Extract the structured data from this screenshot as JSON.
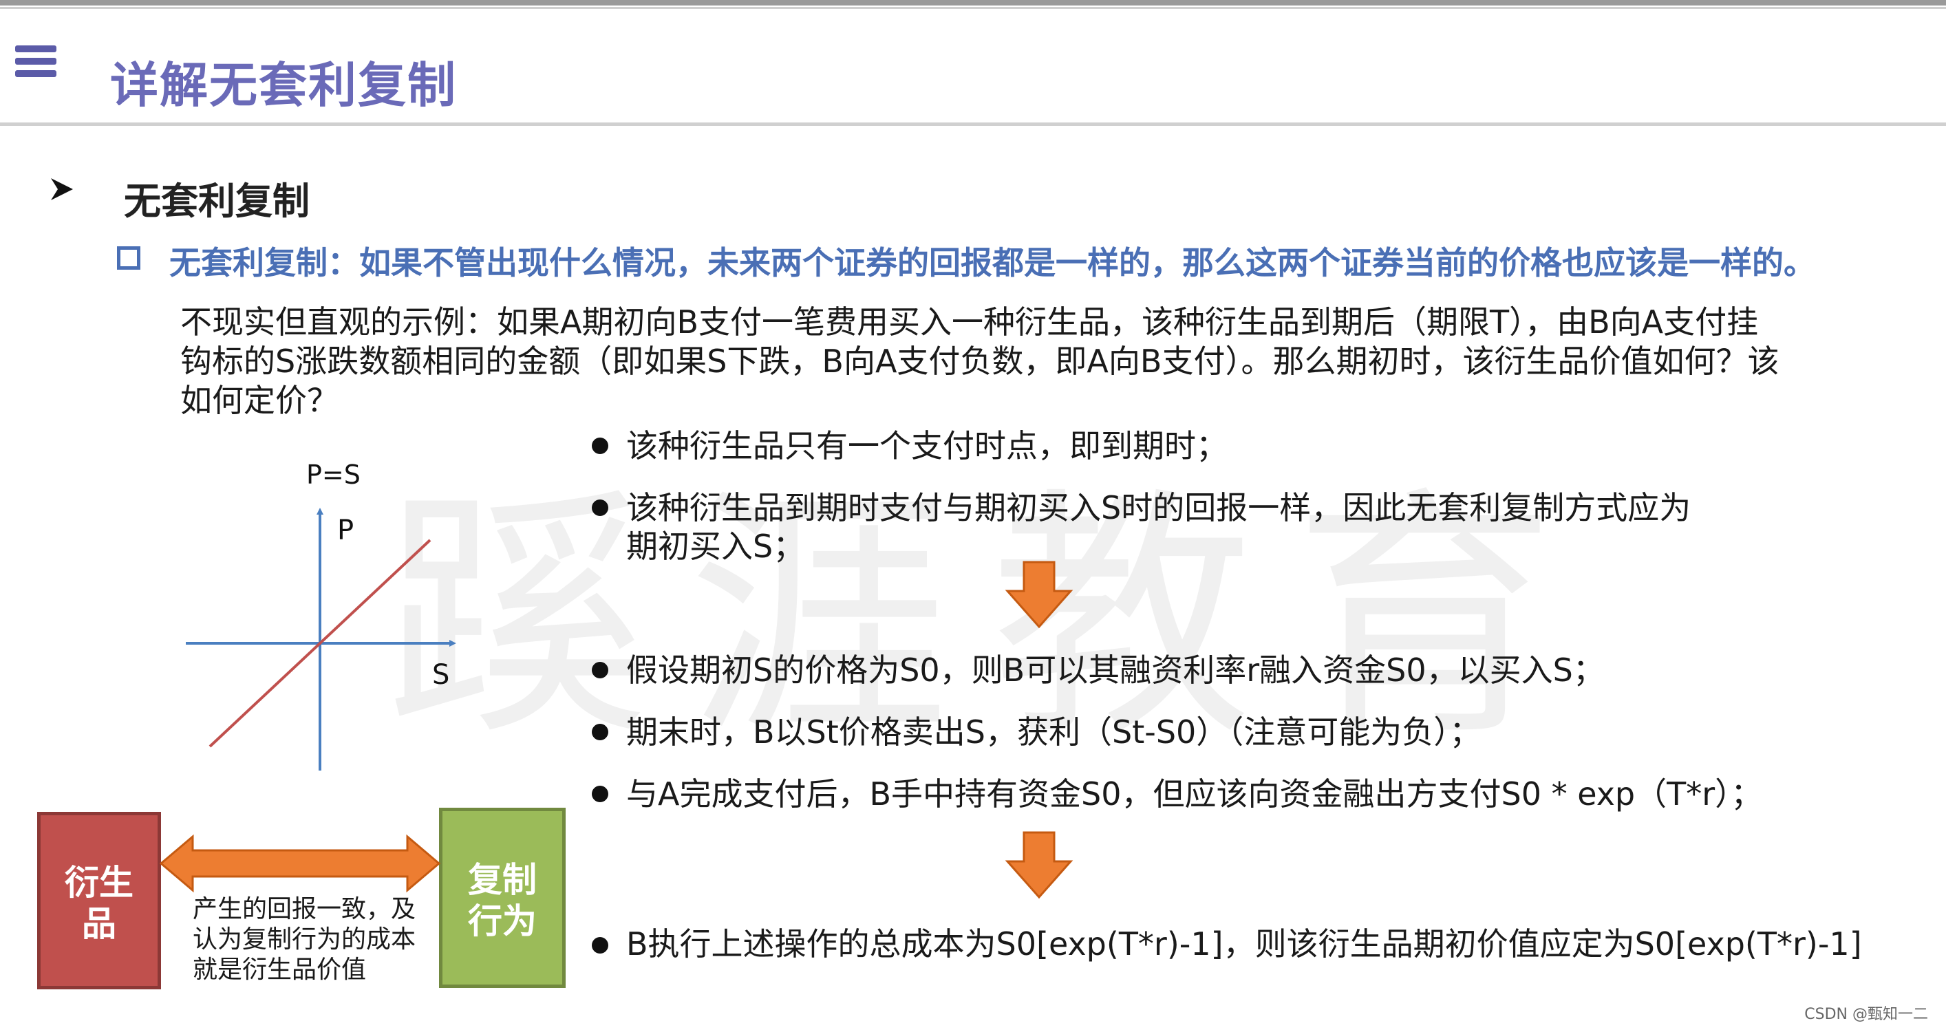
{
  "header": {
    "title": "详解无套利复制"
  },
  "section": {
    "title": "无套利复制",
    "definition": "无套利复制：如果不管出现什么情况，未来两个证券的回报都是一样的，那么这两个证券当前的价格也应该是一样的。",
    "example_line1": "不现实但直观的示例：如果A期初向B支付一笔费用买入一种衍生品，该种衍生品到期后（期限T），由B向A支付挂",
    "example_line2": "钩标的S涨跌数额相同的金额（即如果S下跌，B向A支付负数，即A向B支付）。那么期初时，该衍生品价值如何？该",
    "example_line3": "如何定价？"
  },
  "bullets_group1": [
    "该种衍生品只有一个支付时点，即到期时；",
    "该种衍生品到期时支付与期初买入S时的回报一样，因此无套利复制方式应为",
    "期初买入S；"
  ],
  "bullets_group2": [
    "假设期初S的价格为S0，则B可以其融资利率r融入资金S0，以买入S；",
    "期末时，B以St价格卖出S，获利（St-S0）（注意可能为负）；",
    "与A完成支付后，B手中持有资金S0，但应该向资金融出方支付S0 * exp（T*r）；"
  ],
  "bullet_conclusion": "B执行上述操作的总成本为S0[exp(T*r)-1]，则该衍生品期初价值应定为S0[exp(T*r)-1]",
  "chart": {
    "formula_label": "P=S",
    "y_label": "P",
    "x_label": "S"
  },
  "chart_data": {
    "type": "line",
    "title": "P=S",
    "xlabel": "S",
    "ylabel": "P",
    "series": [
      {
        "x": [
          -1,
          1
        ],
        "y": [
          -1,
          1
        ]
      }
    ],
    "xlim": [
      -1,
      1
    ],
    "ylim": [
      -1,
      1
    ],
    "grid": false
  },
  "diagram": {
    "left_box_line1": "衍生",
    "left_box_line2": "品",
    "right_box_line1": "复制",
    "right_box_line2": "行为",
    "note_line1": "产生的回报一致，及",
    "note_line2": "认为复制行为的成本",
    "note_line3": "就是衍生品价值"
  },
  "footer": {
    "credit": "CSDN @甄知一二"
  },
  "watermark": "蹊涯教育",
  "colors": {
    "title_purple": "#6a6ab8",
    "definition_blue": "#4a6fb5",
    "arrow_orange": "#ed7d31",
    "box_red": "#c0504d",
    "box_green": "#9bbb59",
    "axis_blue": "#4a7fc0",
    "line_red": "#c0504d"
  }
}
